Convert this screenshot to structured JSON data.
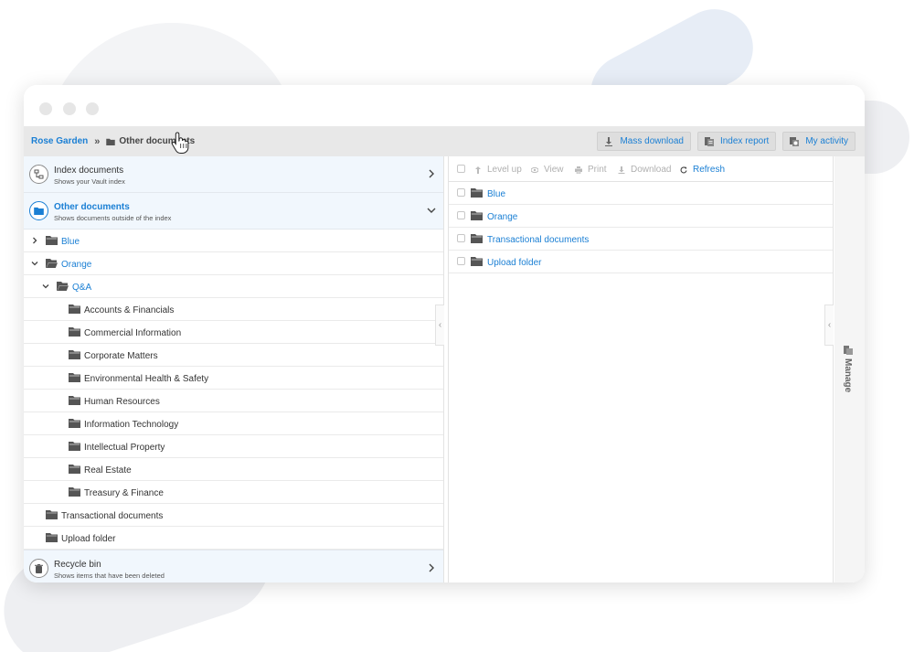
{
  "breadcrumb": {
    "root": "Rose Garden",
    "separator": "»",
    "current": "Other documents"
  },
  "top_actions": [
    {
      "label": "Mass download",
      "icon": "download-icon"
    },
    {
      "label": "Index report",
      "icon": "report-icon"
    },
    {
      "label": "My activity",
      "icon": "activity-icon"
    }
  ],
  "sections": {
    "index": {
      "title": "Index documents",
      "subtitle": "Shows your Vault index"
    },
    "other": {
      "title": "Other documents",
      "subtitle": "Shows documents outside of the index"
    },
    "recycle": {
      "title": "Recycle bin",
      "subtitle": "Shows items that have been deleted"
    }
  },
  "tree": [
    {
      "label": "Blue",
      "level": 0,
      "expander": "collapsed",
      "link": true
    },
    {
      "label": "Orange",
      "level": 0,
      "expander": "expanded",
      "link": true
    },
    {
      "label": "Q&A",
      "level": 1,
      "expander": "expanded",
      "link": true
    },
    {
      "label": "Accounts & Financials",
      "level": 2,
      "expander": "none",
      "link": false
    },
    {
      "label": "Commercial Information",
      "level": 2,
      "expander": "none",
      "link": false
    },
    {
      "label": "Corporate Matters",
      "level": 2,
      "expander": "none",
      "link": false
    },
    {
      "label": "Environmental Health & Safety",
      "level": 2,
      "expander": "none",
      "link": false
    },
    {
      "label": "Human Resources",
      "level": 2,
      "expander": "none",
      "link": false
    },
    {
      "label": "Information Technology",
      "level": 2,
      "expander": "none",
      "link": false
    },
    {
      "label": "Intellectual Property",
      "level": 2,
      "expander": "none",
      "link": false
    },
    {
      "label": "Real Estate",
      "level": 2,
      "expander": "none",
      "link": false
    },
    {
      "label": "Treasury & Finance",
      "level": 2,
      "expander": "none",
      "link": false
    },
    {
      "label": "Transactional documents",
      "level": 0,
      "expander": "none",
      "link": false
    },
    {
      "label": "Upload folder",
      "level": 0,
      "expander": "none",
      "link": false
    }
  ],
  "toolbar": {
    "level_up": "Level up",
    "view": "View",
    "print": "Print",
    "download": "Download",
    "refresh": "Refresh"
  },
  "files": [
    "Blue",
    "Orange",
    "Transactional documents",
    "Upload folder"
  ],
  "manage_label": "Manage",
  "colors": {
    "accent": "#1a7fd4",
    "section_bg": "#f1f7fd",
    "topbar_bg": "#e8e8e8"
  }
}
